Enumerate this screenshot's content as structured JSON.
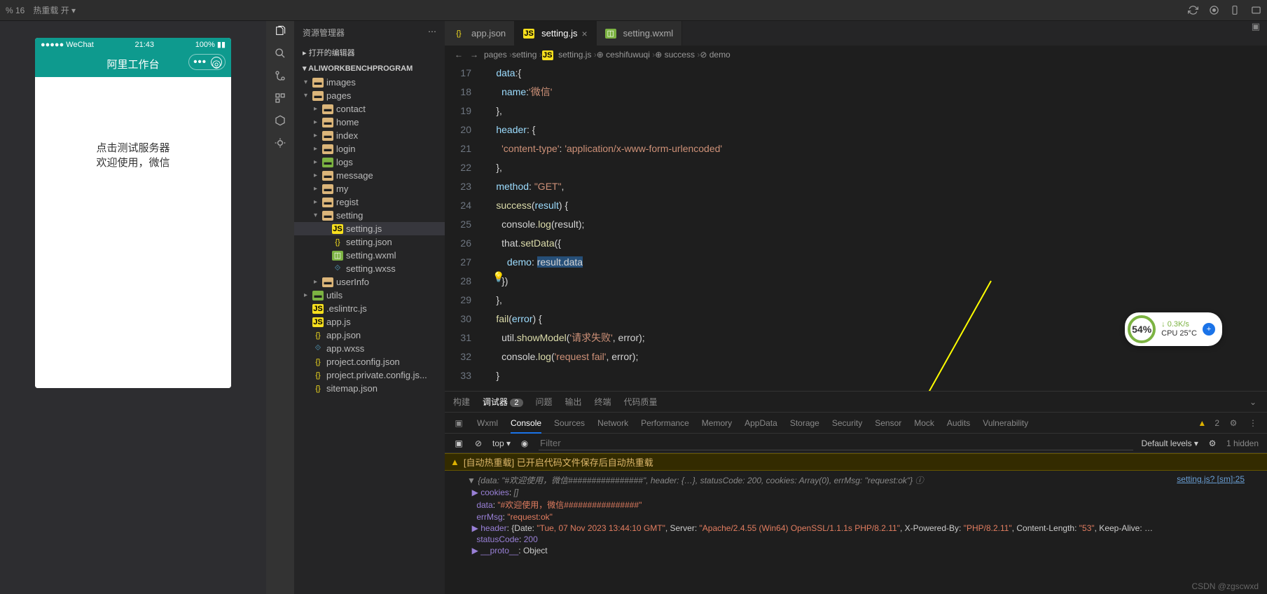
{
  "topbar": {
    "pct": "% 16",
    "hot_reload": "热重载 开",
    "dropdown": "▾"
  },
  "phone": {
    "signal": "●●●●●",
    "carrier": "WeChat",
    "wifi": "⋮",
    "time": "21:43",
    "battery": "100%",
    "title": "阿里工作台",
    "line1": "点击测试服务器",
    "line2": "欢迎使用，微信"
  },
  "explorer": {
    "title": "资源管理器",
    "opened": "打开的编辑器",
    "root": "ALIWORKBENCHPROGRAM",
    "items": [
      {
        "d": 1,
        "t": "folder",
        "l": "images",
        "exp": true,
        "ico": "folder"
      },
      {
        "d": 1,
        "t": "folder",
        "l": "pages",
        "exp": true,
        "ico": "folder"
      },
      {
        "d": 2,
        "t": "folder",
        "l": "contact",
        "exp": false
      },
      {
        "d": 2,
        "t": "folder",
        "l": "home",
        "exp": false
      },
      {
        "d": 2,
        "t": "folder",
        "l": "index",
        "exp": false
      },
      {
        "d": 2,
        "t": "folder",
        "l": "login",
        "exp": false
      },
      {
        "d": 2,
        "t": "folder",
        "l": "logs",
        "exp": false,
        "ico": "folder-g"
      },
      {
        "d": 2,
        "t": "folder",
        "l": "message",
        "exp": false
      },
      {
        "d": 2,
        "t": "folder",
        "l": "my",
        "exp": false
      },
      {
        "d": 2,
        "t": "folder",
        "l": "regist",
        "exp": false
      },
      {
        "d": 2,
        "t": "folder",
        "l": "setting",
        "exp": true
      },
      {
        "d": 3,
        "t": "js",
        "l": "setting.js",
        "active": true
      },
      {
        "d": 3,
        "t": "json",
        "l": "setting.json"
      },
      {
        "d": 3,
        "t": "wxml",
        "l": "setting.wxml"
      },
      {
        "d": 3,
        "t": "wxss",
        "l": "setting.wxss"
      },
      {
        "d": 2,
        "t": "folder",
        "l": "userInfo",
        "exp": false
      },
      {
        "d": 1,
        "t": "folder",
        "l": "utils",
        "exp": false,
        "ico": "folder-g"
      },
      {
        "d": 1,
        "t": "js",
        "l": ".eslintrc.js"
      },
      {
        "d": 1,
        "t": "js",
        "l": "app.js"
      },
      {
        "d": 1,
        "t": "json",
        "l": "app.json"
      },
      {
        "d": 1,
        "t": "wxss",
        "l": "app.wxss"
      },
      {
        "d": 1,
        "t": "json",
        "l": "project.config.json"
      },
      {
        "d": 1,
        "t": "json",
        "l": "project.private.config.js..."
      },
      {
        "d": 1,
        "t": "json",
        "l": "sitemap.json"
      }
    ]
  },
  "tabs": [
    {
      "icon": "json",
      "label": "app.json",
      "active": false,
      "close": false
    },
    {
      "icon": "js",
      "label": "setting.js",
      "active": true,
      "close": true
    },
    {
      "icon": "wxml",
      "label": "setting.wxml",
      "active": false,
      "close": false
    }
  ],
  "breadcrumb": [
    "pages",
    "setting",
    "setting.js",
    "ceshifuwuqi",
    "success",
    "demo"
  ],
  "code": {
    "start": 17,
    "lines": [
      "      data:{",
      "        name:'微信'",
      "      },",
      "      header: {",
      "        'content-type': 'application/x-www-form-urlencoded'",
      "      },",
      "      method: \"GET\",",
      "      success(result) {",
      "        console.log(result);",
      "        that.setData({",
      "          demo: result.data",
      "        })",
      "      },",
      "      fail(error) {",
      "        util.showModel('请求失败', error);",
      "        console.log('request fail', error);",
      "      }"
    ]
  },
  "panel": {
    "tabs": [
      "构建",
      "调试器",
      "问题",
      "输出",
      "终端",
      "代码质量"
    ],
    "badge": "2",
    "subtabs": [
      "Wxml",
      "Console",
      "Sources",
      "Network",
      "Performance",
      "Memory",
      "AppData",
      "Storage",
      "Security",
      "Sensor",
      "Mock",
      "Audits",
      "Vulnerability"
    ],
    "warn_count": "2",
    "top": "top",
    "filter_ph": "Filter",
    "levels": "Default levels",
    "hidden": "1 hidden",
    "warn_line": "[自动热重载] 已开启代码文件保存后自动热重载",
    "log_src": "setting.js? [sm]:25"
  },
  "console": {
    "l0": "▼ {data: \"#欢迎使用，微信################\", header: {…}, statusCode: 200, cookies: Array(0), errMsg: \"request:ok\"} ⓘ",
    "l1": "  ▶ cookies: []",
    "l2": "    data: \"#欢迎使用，微信################\"",
    "l3": "    errMsg: \"request:ok\"",
    "l4a": "  ▶ header: {Date: \"Tue, 07 Nov 2023 13:44:10 GMT\", Server: \"Apache/2.4.55 (Win64) OpenSSL/1.1.1s PHP/8.2.11\", X-Powered-By: \"PHP/8.2.11\", Content-Length: \"53\", Keep-Alive: …",
    "l5": "    statusCode: 200",
    "l6": "  ▶ __proto__: Object"
  },
  "perf": {
    "pct": "54%",
    "net": "0.3K/s",
    "cpu": "CPU 25°C"
  },
  "watermark": "CSDN @zgscwxd"
}
